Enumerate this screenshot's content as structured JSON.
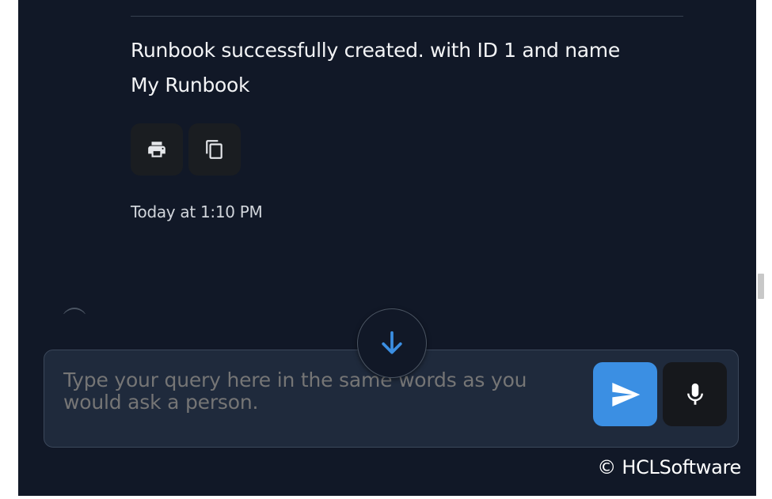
{
  "chat": {
    "message": "Runbook successfully created. with ID 1 and name My Runbook",
    "timestamp": "Today at 1:10 PM",
    "actions": {
      "print_icon": "print-icon",
      "copy_icon": "copy-icon"
    }
  },
  "composer": {
    "placeholder": "Type your query here in the same words as you would ask a person.",
    "send_icon": "send-icon",
    "mic_icon": "microphone-icon",
    "scroll_icon": "arrow-down-icon"
  },
  "footer": {
    "copyright": "© HCLSoftware"
  },
  "colors": {
    "background": "#111827",
    "accent": "#3b8fe3",
    "input_bg": "#1f2a3c"
  }
}
